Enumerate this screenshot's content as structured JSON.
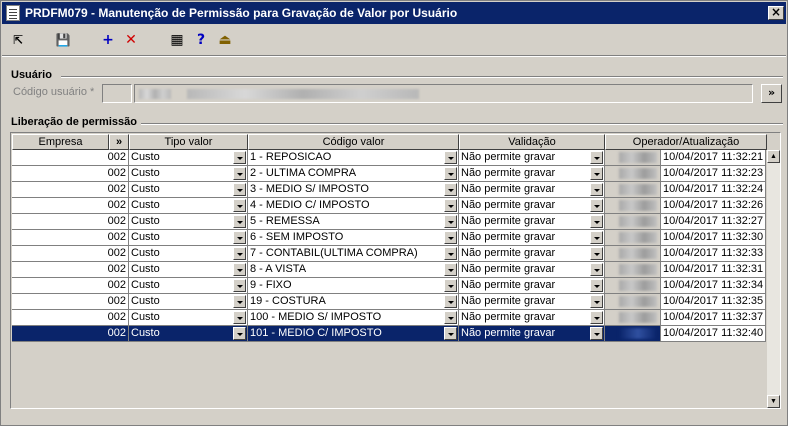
{
  "window": {
    "title": "PRDFM079 - Manutenção de Permissão para Gravação de Valor por Usuário",
    "close_label": "×"
  },
  "toolbar": {
    "buttons": [
      {
        "name": "back-icon",
        "glyph": "⇱",
        "color": "#000000"
      },
      {
        "name": "save-icon",
        "glyph": "💾",
        "color": "#000000"
      },
      {
        "name": "add-icon",
        "glyph": "+",
        "color": "#0000c0"
      },
      {
        "name": "delete-icon",
        "glyph": "✕",
        "color": "#d00000"
      },
      {
        "name": "grid-icon",
        "glyph": "▦",
        "color": "#000000"
      },
      {
        "name": "help-icon",
        "glyph": "?",
        "color": "#0000c0"
      },
      {
        "name": "exit-icon",
        "glyph": "⏏",
        "color": "#806000"
      }
    ]
  },
  "usuario": {
    "group_label": "Usuário",
    "codigo_label": "Código usuário *",
    "lookup_button": "»"
  },
  "liberacao": {
    "group_label": "Liberação de permissão",
    "columns": [
      "Empresa",
      "»",
      "Tipo valor",
      "Código valor",
      "Validação",
      "Operador/Atualização"
    ],
    "rows": [
      {
        "empresa": "002",
        "tipo": "Custo",
        "codigo": "1 - REPOSICAO",
        "validacao": "Não permite gravar",
        "atualizacao": "10/04/2017 11:32:21"
      },
      {
        "empresa": "002",
        "tipo": "Custo",
        "codigo": "2 - ULTIMA COMPRA",
        "validacao": "Não permite gravar",
        "atualizacao": "10/04/2017 11:32:23"
      },
      {
        "empresa": "002",
        "tipo": "Custo",
        "codigo": "3 - MEDIO S/ IMPOSTO",
        "validacao": "Não permite gravar",
        "atualizacao": "10/04/2017 11:32:24"
      },
      {
        "empresa": "002",
        "tipo": "Custo",
        "codigo": "4 - MEDIO C/ IMPOSTO",
        "validacao": "Não permite gravar",
        "atualizacao": "10/04/2017 11:32:26"
      },
      {
        "empresa": "002",
        "tipo": "Custo",
        "codigo": "5 - REMESSA",
        "validacao": "Não permite gravar",
        "atualizacao": "10/04/2017 11:32:27"
      },
      {
        "empresa": "002",
        "tipo": "Custo",
        "codigo": "6 - SEM IMPOSTO",
        "validacao": "Não permite gravar",
        "atualizacao": "10/04/2017 11:32:30"
      },
      {
        "empresa": "002",
        "tipo": "Custo",
        "codigo": "7 - CONTABIL(ULTIMA COMPRA)",
        "validacao": "Não permite gravar",
        "atualizacao": "10/04/2017 11:32:33"
      },
      {
        "empresa": "002",
        "tipo": "Custo",
        "codigo": "8 - A VISTA",
        "validacao": "Não permite gravar",
        "atualizacao": "10/04/2017 11:32:31"
      },
      {
        "empresa": "002",
        "tipo": "Custo",
        "codigo": "9 - FIXO",
        "validacao": "Não permite gravar",
        "atualizacao": "10/04/2017 11:32:34"
      },
      {
        "empresa": "002",
        "tipo": "Custo",
        "codigo": "19 - COSTURA",
        "validacao": "Não permite gravar",
        "atualizacao": "10/04/2017 11:32:35"
      },
      {
        "empresa": "002",
        "tipo": "Custo",
        "codigo": "100 - MEDIO S/ IMPOSTO",
        "validacao": "Não permite gravar",
        "atualizacao": "10/04/2017 11:32:37"
      },
      {
        "empresa": "002",
        "tipo": "Custo",
        "codigo": "101 - MEDIO C/ IMPOSTO",
        "validacao": "Não permite gravar",
        "atualizacao": "10/04/2017 11:32:40",
        "selected": true
      }
    ]
  },
  "colors": {
    "titlebar": "#0a246a",
    "selection": "#0a246a",
    "selected_first_cell": "#c8f0ff",
    "face": "#d4d0c8"
  }
}
